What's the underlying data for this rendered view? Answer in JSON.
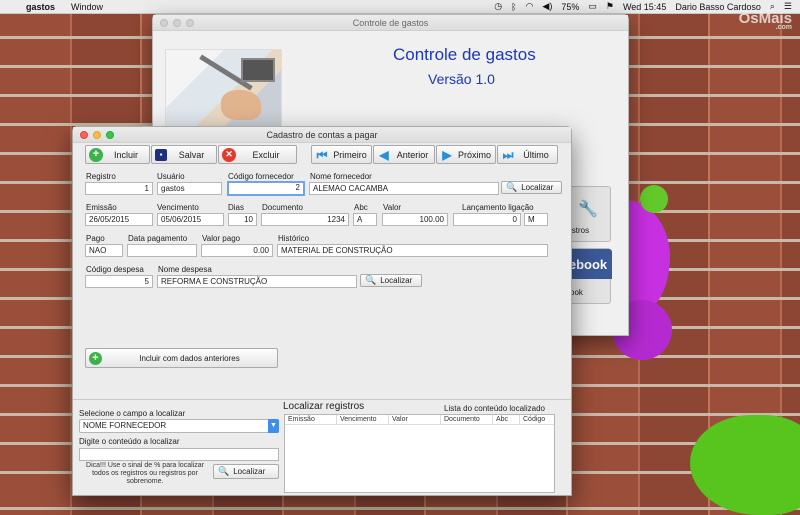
{
  "menubar": {
    "apple": "",
    "app_name": "gastos",
    "menus": [
      "Window"
    ],
    "battery": "75%",
    "clock": "Wed 15:45",
    "user": "Dario Basso Cardoso"
  },
  "brand": {
    "name": "OsMais",
    "sub": ".com"
  },
  "splash": {
    "window_title": "Controle de gastos",
    "title": "Controle de gastos",
    "version": "Versão 1.0",
    "registros_label": "istros",
    "facebook_label": "ebook",
    "facebook_sub": "ook"
  },
  "form": {
    "window_title": "Cadastro de contas a pagar",
    "toolbar": {
      "incluir": "Incluir",
      "salvar": "Salvar",
      "excluir": "Excluir",
      "primeiro": "Primeiro",
      "anterior": "Anterior",
      "proximo": "Próximo",
      "ultimo": "Último"
    },
    "fields": {
      "registro": {
        "label": "Registro",
        "value": "1"
      },
      "usuario": {
        "label": "Usuário",
        "value": "gastos"
      },
      "codigo_fornecedor": {
        "label": "Código fornecedor",
        "value": "2"
      },
      "nome_fornecedor": {
        "label": "Nome fornecedor",
        "value": "ALEMAO CACAMBA"
      },
      "emissao": {
        "label": "Emissão",
        "value": "26/05/2015"
      },
      "vencimento": {
        "label": "Vencimento",
        "value": "05/06/2015"
      },
      "dias": {
        "label": "Dias",
        "value": "10"
      },
      "documento": {
        "label": "Documento",
        "value": "1234"
      },
      "abc": {
        "label": "Abc",
        "value": "A"
      },
      "valor": {
        "label": "Valor",
        "value": "100.00"
      },
      "lancamento_ligacao": {
        "label": "Lançamento ligação",
        "value": "0",
        "value2": "M"
      },
      "pago": {
        "label": "Pago",
        "value": "NAO"
      },
      "data_pagamento": {
        "label": "Data pagamento",
        "value": ""
      },
      "valor_pago": {
        "label": "Valor pago",
        "value": "0.00"
      },
      "historico": {
        "label": "Histórico",
        "value": "MATERIAL DE CONSTRUÇÃO"
      },
      "codigo_despesa": {
        "label": "Código despesa",
        "value": "5"
      },
      "nome_despesa": {
        "label": "Nome despesa",
        "value": "REFORMA E CONSTRUÇÃO"
      }
    },
    "localizar": "Localizar",
    "incluir_anteriores": "Incluir com dados anteriores",
    "search": {
      "select_label": "Selecione o campo a localizar",
      "select_value": "NOME FORNECEDOR",
      "content_label": "Digite o conteúdo a localizar",
      "content_value": "",
      "hint": "Dica!!! Use o sinal de % para localizar todos os registros ou registros por sobrenome.",
      "button": "Localizar"
    },
    "results": {
      "title": "Localizar registros",
      "subtitle": "Lista do conteúdo localizado",
      "columns": [
        "Emissão",
        "Vencimento",
        "Valor",
        "Documento",
        "Abc",
        "Código"
      ]
    }
  }
}
